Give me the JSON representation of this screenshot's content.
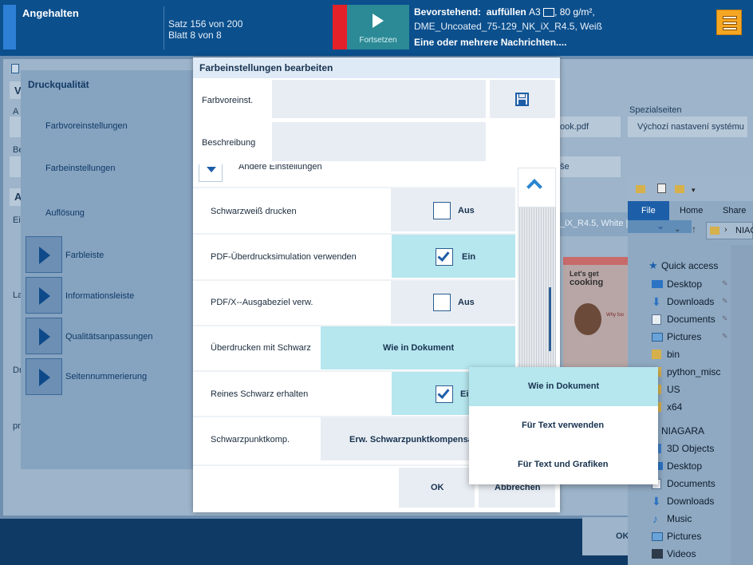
{
  "topbar": {
    "status": "Angehalten",
    "job_line1": "Satz 156 von 200",
    "job_line2": "Blatt 8 von 8",
    "resume_label": "Fortsetzen",
    "upcoming_label": "Bevorstehend:",
    "upcoming_action": "auffüllen",
    "upcoming_media_prefix": "A3",
    "upcoming_media_suffix": ", 80 g/m²,",
    "upcoming_media_line2": "DME_Uncoated_75-129_NK_iX_R4.5, Weiß",
    "messages": "Eine oder mehrere Nachrichten...."
  },
  "sidebar": {
    "title": "Druckqualität",
    "items": [
      {
        "label": "Farbvoreinstellungen"
      },
      {
        "label": "Farbeinstellungen"
      },
      {
        "label": "Auflösung"
      },
      {
        "label": "Farbleiste"
      },
      {
        "label": "Informationsleiste"
      },
      {
        "label": "Qualitätsanpassungen"
      },
      {
        "label": "Seitennummerierung"
      }
    ]
  },
  "background": {
    "col_special_header": "Spezialseiten",
    "col_special_value": "Výchozí nastavení systému",
    "book_value": "ook.pdf",
    "misc_value": "še",
    "media_value": "_iX_R4.5, White |",
    "letters": [
      "V",
      "A",
      "Be",
      "A",
      "Ei",
      "La",
      "Dr",
      "pr"
    ],
    "ok_label": "OK"
  },
  "dialog": {
    "title": "Farbeinstellungen bearbeiten",
    "preset_label": "Farbvoreinst.",
    "description_label": "Beschreibung",
    "other_settings_label": "Andere Einstellungen",
    "rows": [
      {
        "label": "Schwarzweiß drucken",
        "value": "Aus"
      },
      {
        "label": "PDF-Überdrucksimulation verwenden",
        "value": "Ein"
      },
      {
        "label": "PDF/X--Ausgabeziel verw.",
        "value": "Aus"
      },
      {
        "label": "Überdrucken mit Schwarz",
        "value": "Wie in Dokument"
      },
      {
        "label": "Reines Schwarz erhalten",
        "value": "Ein"
      },
      {
        "label": "Schwarzpunktkomp.",
        "value": "Erw. Schwarzpunktkompensa"
      }
    ],
    "ok_label": "OK",
    "cancel_label": "Abbrechen"
  },
  "dropdown": {
    "options": [
      "Wie in Dokument",
      "Für Text verwenden",
      "Für Text und Grafiken"
    ],
    "selected": "Wie in Dokument"
  },
  "explorer": {
    "tabs": [
      "File",
      "Home",
      "Share"
    ],
    "path": "NIAGA",
    "quick_access": "Quick access",
    "items": [
      {
        "label": "Desktop",
        "icon": "desktop-icon",
        "pinned": true
      },
      {
        "label": "Downloads",
        "icon": "download-icon",
        "pinned": true
      },
      {
        "label": "Documents",
        "icon": "documents-icon",
        "pinned": true
      },
      {
        "label": "Pictures",
        "icon": "pictures-icon",
        "pinned": true
      },
      {
        "label": "bin",
        "icon": "folder-icon",
        "pinned": false
      },
      {
        "label": "python_misc",
        "icon": "folder-icon",
        "pinned": false
      },
      {
        "label": "US",
        "icon": "folder-icon",
        "pinned": false
      },
      {
        "label": "x64",
        "icon": "folder-icon",
        "pinned": false
      }
    ],
    "pc_label": "NIAGARA",
    "pc_items": [
      {
        "label": "3D Objects",
        "icon": "3d-objects-icon"
      },
      {
        "label": "Desktop",
        "icon": "desktop-icon"
      },
      {
        "label": "Documents",
        "icon": "documents-icon"
      },
      {
        "label": "Downloads",
        "icon": "download-icon"
      },
      {
        "label": "Music",
        "icon": "music-icon"
      },
      {
        "label": "Pictures",
        "icon": "pictures-icon"
      },
      {
        "label": "Videos",
        "icon": "videos-icon"
      }
    ]
  },
  "preview": {
    "title_line1": "Let's get",
    "title_line2": "cooking",
    "line3": "Why foo"
  },
  "colors": {
    "topbar": "#0b4f8d",
    "accent_cyan": "#b6e6ee",
    "alert_red": "#e32128",
    "resume_teal": "#2b8a96",
    "icon_orange": "#f5a623"
  }
}
